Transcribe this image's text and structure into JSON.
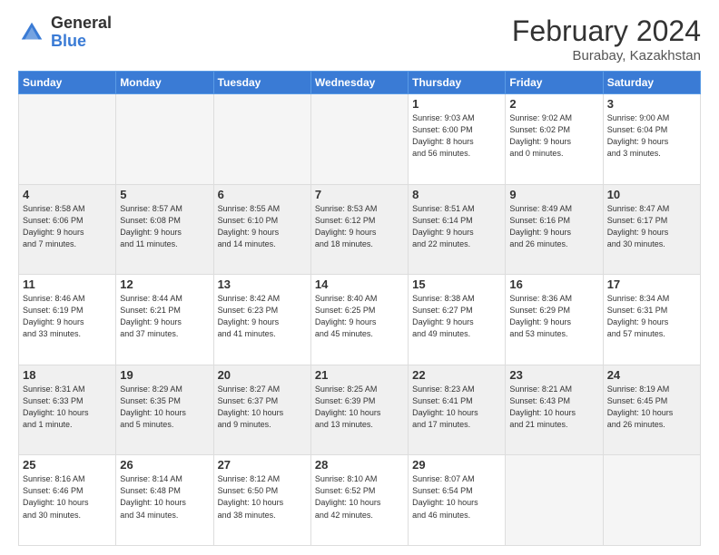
{
  "header": {
    "logo_general": "General",
    "logo_blue": "Blue",
    "title": "February 2024",
    "location": "Burabay, Kazakhstan"
  },
  "days_of_week": [
    "Sunday",
    "Monday",
    "Tuesday",
    "Wednesday",
    "Thursday",
    "Friday",
    "Saturday"
  ],
  "weeks": [
    {
      "shaded": false,
      "days": [
        {
          "num": "",
          "info": ""
        },
        {
          "num": "",
          "info": ""
        },
        {
          "num": "",
          "info": ""
        },
        {
          "num": "",
          "info": ""
        },
        {
          "num": "1",
          "info": "Sunrise: 9:03 AM\nSunset: 6:00 PM\nDaylight: 8 hours\nand 56 minutes."
        },
        {
          "num": "2",
          "info": "Sunrise: 9:02 AM\nSunset: 6:02 PM\nDaylight: 9 hours\nand 0 minutes."
        },
        {
          "num": "3",
          "info": "Sunrise: 9:00 AM\nSunset: 6:04 PM\nDaylight: 9 hours\nand 3 minutes."
        }
      ]
    },
    {
      "shaded": true,
      "days": [
        {
          "num": "4",
          "info": "Sunrise: 8:58 AM\nSunset: 6:06 PM\nDaylight: 9 hours\nand 7 minutes."
        },
        {
          "num": "5",
          "info": "Sunrise: 8:57 AM\nSunset: 6:08 PM\nDaylight: 9 hours\nand 11 minutes."
        },
        {
          "num": "6",
          "info": "Sunrise: 8:55 AM\nSunset: 6:10 PM\nDaylight: 9 hours\nand 14 minutes."
        },
        {
          "num": "7",
          "info": "Sunrise: 8:53 AM\nSunset: 6:12 PM\nDaylight: 9 hours\nand 18 minutes."
        },
        {
          "num": "8",
          "info": "Sunrise: 8:51 AM\nSunset: 6:14 PM\nDaylight: 9 hours\nand 22 minutes."
        },
        {
          "num": "9",
          "info": "Sunrise: 8:49 AM\nSunset: 6:16 PM\nDaylight: 9 hours\nand 26 minutes."
        },
        {
          "num": "10",
          "info": "Sunrise: 8:47 AM\nSunset: 6:17 PM\nDaylight: 9 hours\nand 30 minutes."
        }
      ]
    },
    {
      "shaded": false,
      "days": [
        {
          "num": "11",
          "info": "Sunrise: 8:46 AM\nSunset: 6:19 PM\nDaylight: 9 hours\nand 33 minutes."
        },
        {
          "num": "12",
          "info": "Sunrise: 8:44 AM\nSunset: 6:21 PM\nDaylight: 9 hours\nand 37 minutes."
        },
        {
          "num": "13",
          "info": "Sunrise: 8:42 AM\nSunset: 6:23 PM\nDaylight: 9 hours\nand 41 minutes."
        },
        {
          "num": "14",
          "info": "Sunrise: 8:40 AM\nSunset: 6:25 PM\nDaylight: 9 hours\nand 45 minutes."
        },
        {
          "num": "15",
          "info": "Sunrise: 8:38 AM\nSunset: 6:27 PM\nDaylight: 9 hours\nand 49 minutes."
        },
        {
          "num": "16",
          "info": "Sunrise: 8:36 AM\nSunset: 6:29 PM\nDaylight: 9 hours\nand 53 minutes."
        },
        {
          "num": "17",
          "info": "Sunrise: 8:34 AM\nSunset: 6:31 PM\nDaylight: 9 hours\nand 57 minutes."
        }
      ]
    },
    {
      "shaded": true,
      "days": [
        {
          "num": "18",
          "info": "Sunrise: 8:31 AM\nSunset: 6:33 PM\nDaylight: 10 hours\nand 1 minute."
        },
        {
          "num": "19",
          "info": "Sunrise: 8:29 AM\nSunset: 6:35 PM\nDaylight: 10 hours\nand 5 minutes."
        },
        {
          "num": "20",
          "info": "Sunrise: 8:27 AM\nSunset: 6:37 PM\nDaylight: 10 hours\nand 9 minutes."
        },
        {
          "num": "21",
          "info": "Sunrise: 8:25 AM\nSunset: 6:39 PM\nDaylight: 10 hours\nand 13 minutes."
        },
        {
          "num": "22",
          "info": "Sunrise: 8:23 AM\nSunset: 6:41 PM\nDaylight: 10 hours\nand 17 minutes."
        },
        {
          "num": "23",
          "info": "Sunrise: 8:21 AM\nSunset: 6:43 PM\nDaylight: 10 hours\nand 21 minutes."
        },
        {
          "num": "24",
          "info": "Sunrise: 8:19 AM\nSunset: 6:45 PM\nDaylight: 10 hours\nand 26 minutes."
        }
      ]
    },
    {
      "shaded": false,
      "days": [
        {
          "num": "25",
          "info": "Sunrise: 8:16 AM\nSunset: 6:46 PM\nDaylight: 10 hours\nand 30 minutes."
        },
        {
          "num": "26",
          "info": "Sunrise: 8:14 AM\nSunset: 6:48 PM\nDaylight: 10 hours\nand 34 minutes."
        },
        {
          "num": "27",
          "info": "Sunrise: 8:12 AM\nSunset: 6:50 PM\nDaylight: 10 hours\nand 38 minutes."
        },
        {
          "num": "28",
          "info": "Sunrise: 8:10 AM\nSunset: 6:52 PM\nDaylight: 10 hours\nand 42 minutes."
        },
        {
          "num": "29",
          "info": "Sunrise: 8:07 AM\nSunset: 6:54 PM\nDaylight: 10 hours\nand 46 minutes."
        },
        {
          "num": "",
          "info": ""
        },
        {
          "num": "",
          "info": ""
        }
      ]
    }
  ]
}
